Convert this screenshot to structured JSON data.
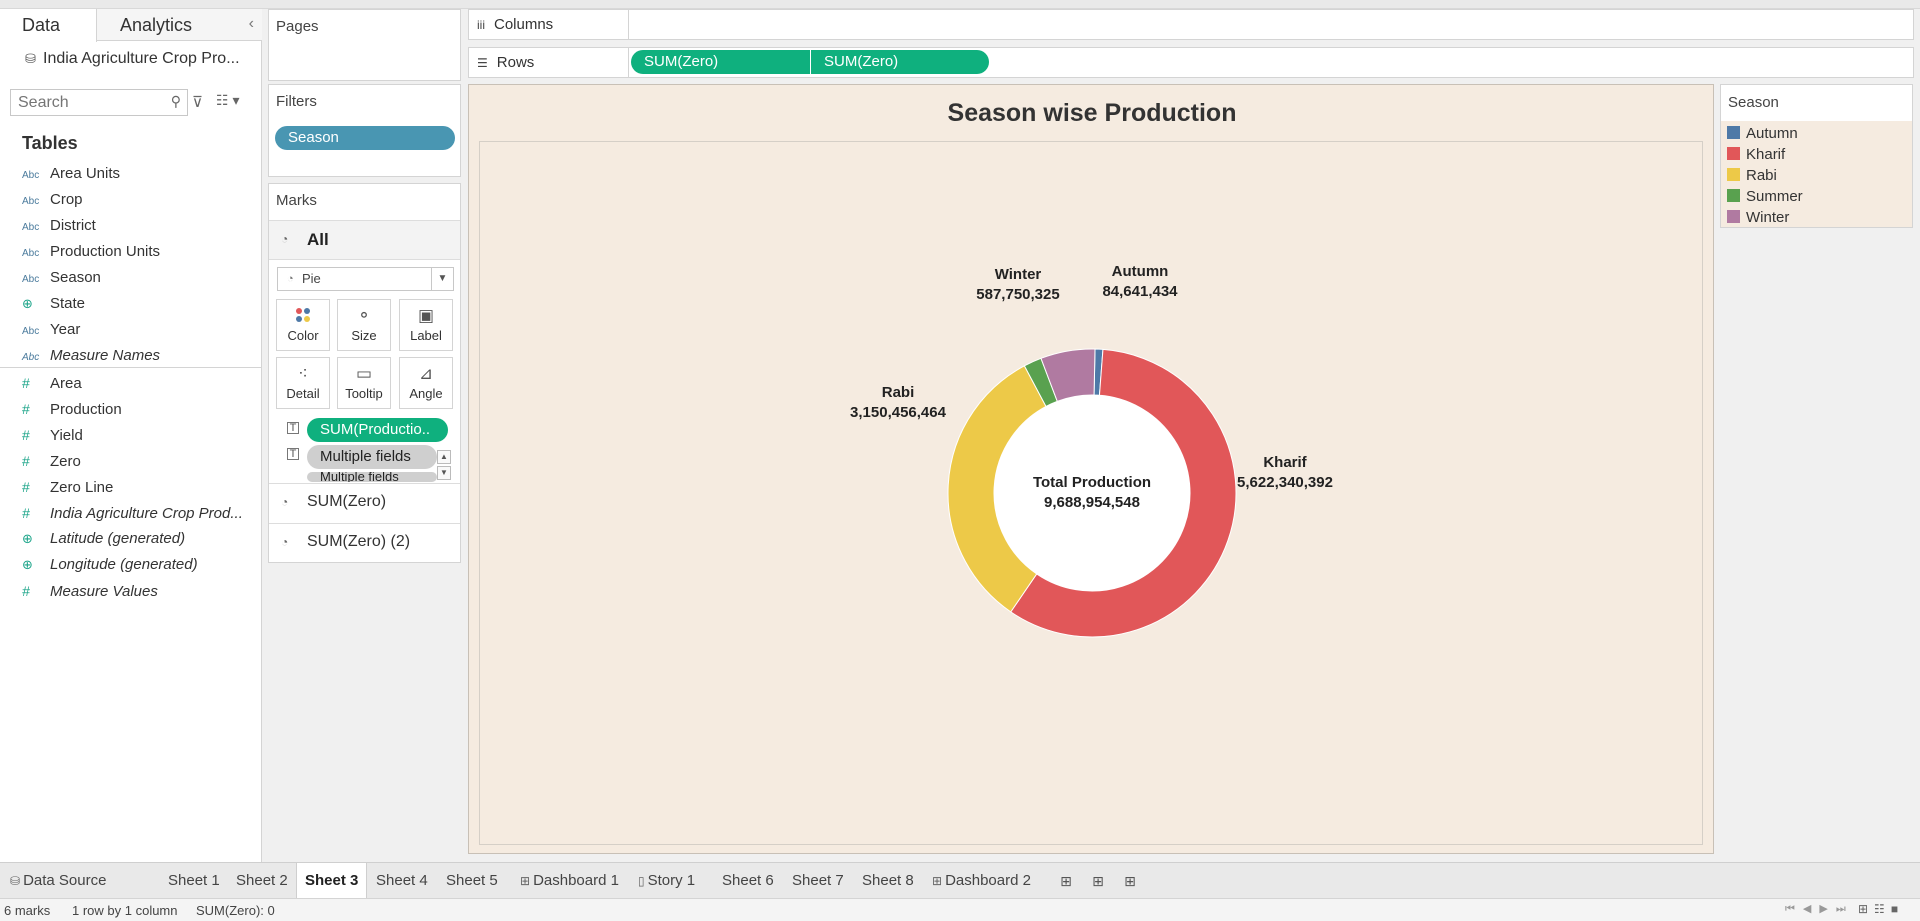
{
  "data_pane": {
    "tabs": [
      "Data",
      "Analytics"
    ],
    "datasource": "India Agriculture Crop Pro...",
    "search_placeholder": "Search",
    "tables_heading": "Tables",
    "fields": [
      {
        "type": "Abc",
        "name": "Area Units",
        "italic": false
      },
      {
        "type": "Abc",
        "name": "Crop",
        "italic": false
      },
      {
        "type": "Abc",
        "name": "District",
        "italic": false
      },
      {
        "type": "Abc",
        "name": "Production Units",
        "italic": false
      },
      {
        "type": "Abc",
        "name": "Season",
        "italic": false
      },
      {
        "type": "geo",
        "name": "State",
        "italic": false
      },
      {
        "type": "Abc",
        "name": "Year",
        "italic": false
      },
      {
        "type": "Abc",
        "name": "Measure Names",
        "italic": true
      },
      {
        "type": "num",
        "name": "Area",
        "italic": false
      },
      {
        "type": "num",
        "name": "Production",
        "italic": false
      },
      {
        "type": "num",
        "name": "Yield",
        "italic": false
      },
      {
        "type": "num",
        "name": "Zero",
        "italic": false
      },
      {
        "type": "num",
        "name": "Zero Line",
        "italic": false
      },
      {
        "type": "num",
        "name": "India Agriculture Crop Prod...",
        "italic": true
      },
      {
        "type": "geo",
        "name": "Latitude (generated)",
        "italic": true
      },
      {
        "type": "geo",
        "name": "Longitude (generated)",
        "italic": true
      },
      {
        "type": "num",
        "name": "Measure Values",
        "italic": true
      }
    ]
  },
  "pages_card": {
    "title": "Pages"
  },
  "filters_card": {
    "title": "Filters",
    "pill": "Season"
  },
  "marks_card": {
    "title": "Marks",
    "all_label": "All",
    "mark_type": "Pie",
    "buttons": [
      "Color",
      "Size",
      "Label",
      "Detail",
      "Tooltip",
      "Angle"
    ],
    "fields": [
      "SUM(Productio..",
      "Multiple fields",
      "Multiple fields"
    ],
    "sub_layers": [
      "SUM(Zero)",
      "SUM(Zero) (2)"
    ]
  },
  "shelves": {
    "columns_label": "Columns",
    "rows_label": "Rows",
    "rows_pills": [
      "SUM(Zero)",
      "SUM(Zero)"
    ]
  },
  "view": {
    "title": "Season wise Production",
    "center_label": "Total Production",
    "center_value": "9,688,954,548"
  },
  "legend": {
    "title": "Season",
    "items": [
      {
        "name": "Autumn",
        "color": "#4e79a7"
      },
      {
        "name": "Kharif",
        "color": "#e15759"
      },
      {
        "name": "Rabi",
        "color": "#edc948"
      },
      {
        "name": "Summer",
        "color": "#59a14f"
      },
      {
        "name": "Winter",
        "color": "#b07aa1"
      }
    ]
  },
  "chart_data": {
    "type": "pie",
    "title": "Season wise Production",
    "categories": [
      "Autumn",
      "Kharif",
      "Rabi",
      "Summer",
      "Winter"
    ],
    "values": [
      84641434,
      5622340392,
      3150456464,
      193765933,
      587750325
    ],
    "labels": {
      "Autumn": "84,641,434",
      "Kharif": "5,622,340,392",
      "Rabi": "3,150,456,464",
      "Winter": "587,750,325"
    },
    "colors": [
      "#4e79a7",
      "#e15759",
      "#edc948",
      "#59a14f",
      "#b07aa1"
    ],
    "donut": true,
    "total_label": "Total Production",
    "total": "9,688,954,548",
    "legend": "right"
  },
  "tabs": [
    {
      "label": "Data Source",
      "icon": "datasource",
      "active": false
    },
    {
      "label": "Sheet 1",
      "icon": "",
      "active": false
    },
    {
      "label": "Sheet 2",
      "icon": "",
      "active": false
    },
    {
      "label": "Sheet 3",
      "icon": "",
      "active": true
    },
    {
      "label": "Sheet 4",
      "icon": "",
      "active": false
    },
    {
      "label": "Sheet 5",
      "icon": "",
      "active": false
    },
    {
      "label": "Dashboard 1",
      "icon": "dashboard",
      "active": false
    },
    {
      "label": "Story 1",
      "icon": "story",
      "active": false
    },
    {
      "label": "Sheet 6",
      "icon": "",
      "active": false
    },
    {
      "label": "Sheet 7",
      "icon": "",
      "active": false
    },
    {
      "label": "Sheet 8",
      "icon": "",
      "active": false
    },
    {
      "label": "Dashboard 2",
      "icon": "dashboard",
      "active": false
    }
  ],
  "status": {
    "marks": "6 marks",
    "layout": "1 row by 1 column",
    "sum": "SUM(Zero): 0"
  }
}
